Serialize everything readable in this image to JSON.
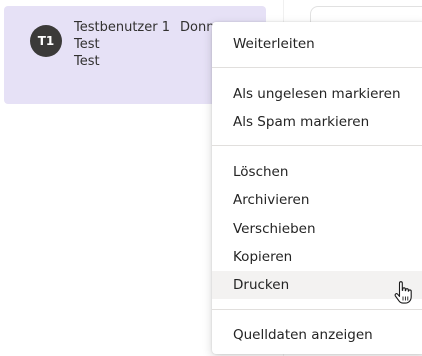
{
  "mail_item": {
    "avatar_initials": "T1",
    "sender": "Testbenutzer 1",
    "date_truncated": "Donne",
    "subject": "Test",
    "preview": "Test"
  },
  "context_menu": {
    "groups": [
      [
        "Weiterleiten"
      ],
      [
        "Als ungelesen markieren",
        "Als Spam markieren"
      ],
      [
        "Löschen",
        "Archivieren",
        "Verschieben",
        "Kopieren",
        "Drucken"
      ],
      [
        "Quelldaten anzeigen"
      ]
    ],
    "hovered_item": "Drucken"
  },
  "colors": {
    "selected_item_bg": "#e6e1f6",
    "avatar_bg": "#3b3a39",
    "menu_hover_bg": "#f3f2f1"
  },
  "cursor": "hand-pointer-icon"
}
